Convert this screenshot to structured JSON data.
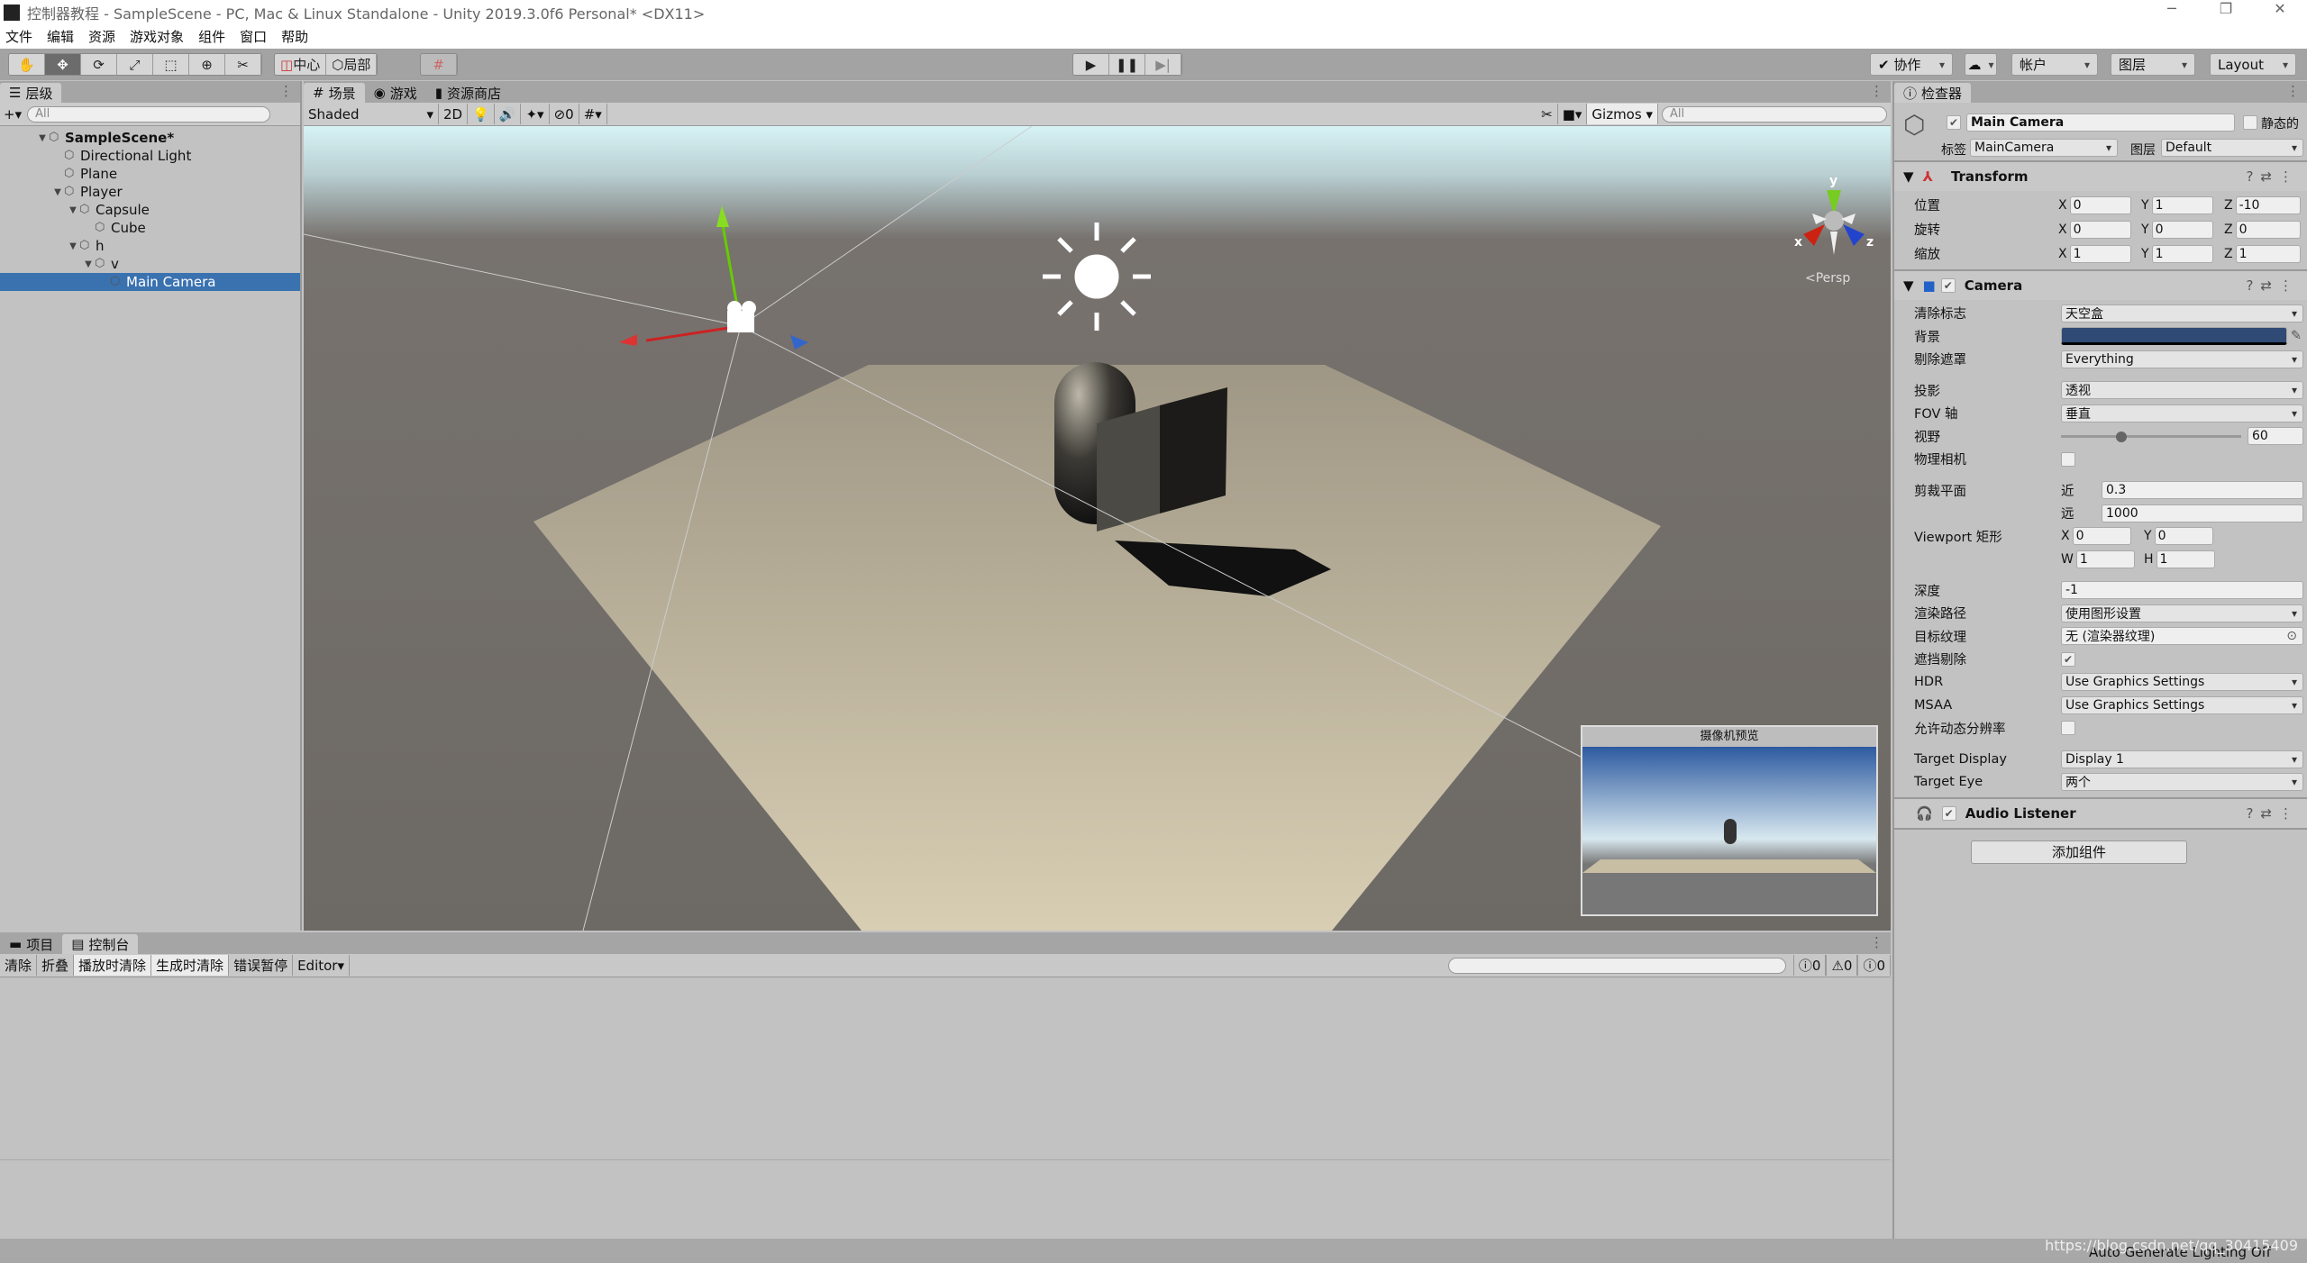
{
  "window": {
    "title": "控制器教程 - SampleScene - PC, Mac & Linux Standalone - Unity 2019.3.0f6 Personal* <DX11>",
    "controls": [
      "─",
      "❐",
      "✕"
    ]
  },
  "menu": [
    "文件",
    "编辑",
    "资源",
    "游戏对象",
    "组件",
    "窗口",
    "帮助"
  ],
  "toolbar": {
    "tools": [
      "hand",
      "move",
      "rotate",
      "scale",
      "rect",
      "transform",
      "custom"
    ],
    "pivot": "中心",
    "space": "局部",
    "collab": "协作",
    "account": "帐户",
    "layers": "图层",
    "layout": "Layout"
  },
  "hierarchy": {
    "tab": "层级",
    "search": "All",
    "rows": [
      {
        "label": "SampleScene*",
        "depth": 0,
        "expanded": true,
        "bold": true,
        "selected": false
      },
      {
        "label": "Directional Light",
        "depth": 1,
        "expanded": null,
        "bold": false,
        "selected": false
      },
      {
        "label": "Plane",
        "depth": 1,
        "expanded": null,
        "bold": false,
        "selected": false
      },
      {
        "label": "Player",
        "depth": 1,
        "expanded": true,
        "bold": false,
        "selected": false
      },
      {
        "label": "Capsule",
        "depth": 2,
        "expanded": true,
        "bold": false,
        "selected": false
      },
      {
        "label": "Cube",
        "depth": 3,
        "expanded": null,
        "bold": false,
        "selected": false
      },
      {
        "label": "h",
        "depth": 2,
        "expanded": true,
        "bold": false,
        "selected": false
      },
      {
        "label": "v",
        "depth": 3,
        "expanded": true,
        "bold": false,
        "selected": false
      },
      {
        "label": "Main Camera",
        "depth": 4,
        "expanded": null,
        "bold": false,
        "selected": true
      }
    ]
  },
  "scene": {
    "tabs": [
      "场景",
      "游戏",
      "资源商店"
    ],
    "shading": "Shaded",
    "mode2d": "2D",
    "hidden_count": "0",
    "gizmos": "Gizmos",
    "search": "All",
    "persp": "<Persp",
    "axes": {
      "x": "x",
      "y": "y",
      "z": "z"
    },
    "preview_title": "摄像机预览"
  },
  "console": {
    "tabs": [
      "项目",
      "控制台"
    ],
    "buttons": [
      "清除",
      "折叠",
      "播放时清除",
      "生成时清除",
      "错误暂停"
    ],
    "active": [
      false,
      false,
      true,
      true,
      false
    ],
    "editor": "Editor",
    "counts": {
      "info": "0",
      "warn": "0",
      "error": "0"
    }
  },
  "inspector": {
    "tab": "检查器",
    "name": "Main Camera",
    "static_label": "静态的",
    "tag_label": "标签",
    "tag": "MainCamera",
    "layer_label": "图层",
    "layer": "Default",
    "transform": {
      "title": "Transform",
      "rows": [
        {
          "label": "位置",
          "x": "0",
          "y": "1",
          "z": "-10"
        },
        {
          "label": "旋转",
          "x": "0",
          "y": "0",
          "z": "0"
        },
        {
          "label": "缩放",
          "x": "1",
          "y": "1",
          "z": "1"
        }
      ]
    },
    "camera": {
      "title": "Camera",
      "rows": [
        {
          "label": "清除标志",
          "type": "drop",
          "value": "天空盒",
          "gap": false
        },
        {
          "label": "背景",
          "type": "color",
          "value": "#2f4a74",
          "gap": false
        },
        {
          "label": "剔除遮罩",
          "type": "drop",
          "value": "Everything",
          "gap": false
        },
        {
          "label": "投影",
          "type": "drop",
          "value": "透视",
          "gap": true
        },
        {
          "label": "FOV 轴",
          "type": "drop",
          "value": "垂直",
          "gap": false
        },
        {
          "label": "视野",
          "type": "slider",
          "value": "60",
          "gap": false
        },
        {
          "label": "物理相机",
          "type": "check",
          "value": false,
          "gap": false
        },
        {
          "label": "剪裁平面",
          "type": "sub",
          "sub": "近",
          "value": "0.3",
          "gap": true
        },
        {
          "label": "",
          "type": "sub",
          "sub": "远",
          "value": "1000",
          "gap": false
        },
        {
          "label": "Viewport 矩形",
          "type": "pair",
          "a": "X",
          "av": "0",
          "b": "Y",
          "bv": "0",
          "gap": false
        },
        {
          "label": "",
          "type": "pair",
          "a": "W",
          "av": "1",
          "b": "H",
          "bv": "1",
          "gap": false
        },
        {
          "label": "深度",
          "type": "text",
          "value": "-1",
          "gap": true
        },
        {
          "label": "渲染路径",
          "type": "drop",
          "value": "使用图形设置",
          "gap": false
        },
        {
          "label": "目标纹理",
          "type": "object",
          "value": "无 (渲染器纹理)",
          "gap": false
        },
        {
          "label": "遮挡剔除",
          "type": "check",
          "value": true,
          "gap": false
        },
        {
          "label": "HDR",
          "type": "drop",
          "value": "Use Graphics Settings",
          "gap": false
        },
        {
          "label": "MSAA",
          "type": "drop",
          "value": "Use Graphics Settings",
          "gap": false
        },
        {
          "label": "允许动态分辨率",
          "type": "check",
          "value": false,
          "gap": false
        },
        {
          "label": "Target Display",
          "type": "drop",
          "value": "Display 1",
          "gap": true
        },
        {
          "label": "Target Eye",
          "type": "drop",
          "value": "两个",
          "gap": false
        }
      ]
    },
    "audio": {
      "title": "Audio Listener"
    },
    "add_component": "添加组件"
  },
  "status": {
    "text": "Auto Generate Lighting Off",
    "watermark": "https://blog.csdn.net/qq_30415409"
  },
  "colors": {
    "selection": "#3a72b0",
    "sky_top": "#d6f3f5",
    "ground": "#6f6b67",
    "plane": "#c8bea3"
  }
}
